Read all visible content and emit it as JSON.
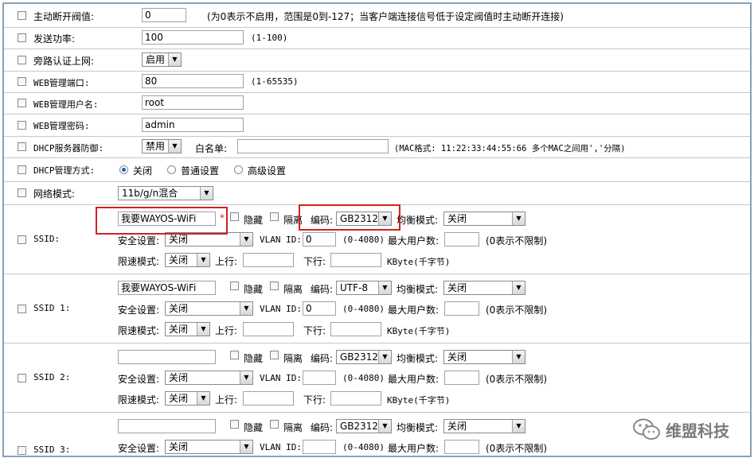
{
  "rows": {
    "disconnect": {
      "label": "主动断开阀值:",
      "value": "0",
      "note": "(为0表示不启用，范围是0到-127；当客户端连接信号低于设定阀值时主动断开连接)"
    },
    "tx_power": {
      "label": "发送功率:",
      "value": "100",
      "note": "(1-100)"
    },
    "bypass_auth": {
      "label": "旁路认证上网:",
      "value": "启用"
    },
    "web_port": {
      "label": "WEB管理端口:",
      "value": "80",
      "note": "(1-65535)"
    },
    "web_user": {
      "label": "WEB管理用户名:",
      "value": "root"
    },
    "web_pass": {
      "label": "WEB管理密码:",
      "value": "admin"
    },
    "dhcp_guard": {
      "label": "DHCP服务器防御:",
      "value": "禁用",
      "whitelist_label": "白名单:",
      "whitelist_value": "",
      "note": "(MAC格式: 11:22:33:44:55:66 多个MAC之间用','分隔)"
    },
    "dhcp_mode": {
      "label": "DHCP管理方式:",
      "options": [
        "关闭",
        "普通设置",
        "高级设置"
      ],
      "selected": "关闭"
    },
    "net_mode": {
      "label": "网络模式:",
      "value": "11b/g/n混合"
    }
  },
  "ssid_common": {
    "hide_label": "隐藏",
    "isolate_label": "隔离",
    "encoding_label": "编码:",
    "balance_label": "均衡模式:",
    "security_label": "安全设置:",
    "vlan_label": "VLAN ID:",
    "vlan_range": "(0-4080)",
    "max_users_label": "最大用户数:",
    "max_users_note": "(0表示不限制)",
    "limit_label": "限速模式:",
    "up_label": "上行:",
    "down_label": "下行:",
    "kbyte_note": "KByte(千字节)"
  },
  "ssids": [
    {
      "label": "SSID:",
      "name": "我要WAYOS-WiFi",
      "encoding": "GB2312",
      "balance": "关闭",
      "security": "关闭",
      "vlan": "0",
      "max_users": "",
      "limit": "关闭",
      "up": "",
      "down": ""
    },
    {
      "label": "SSID 1:",
      "name": "我要WAYOS-WiFi",
      "encoding": "UTF-8",
      "balance": "关闭",
      "security": "关闭",
      "vlan": "0",
      "max_users": "",
      "limit": "关闭",
      "up": "",
      "down": ""
    },
    {
      "label": "SSID 2:",
      "name": "",
      "encoding": "GB2312",
      "balance": "关闭",
      "security": "关闭",
      "vlan": "",
      "max_users": "",
      "limit": "关闭",
      "up": "",
      "down": ""
    },
    {
      "label": "SSID 3:",
      "name": "",
      "encoding": "GB2312",
      "balance": "关闭",
      "security": "关闭",
      "vlan": "",
      "max_users": ""
    }
  ],
  "watermark": {
    "text": "维盟科技",
    "icon": "wechat-icon"
  },
  "colors": {
    "highlight": "#d62020",
    "border": "#8aa0b6"
  }
}
